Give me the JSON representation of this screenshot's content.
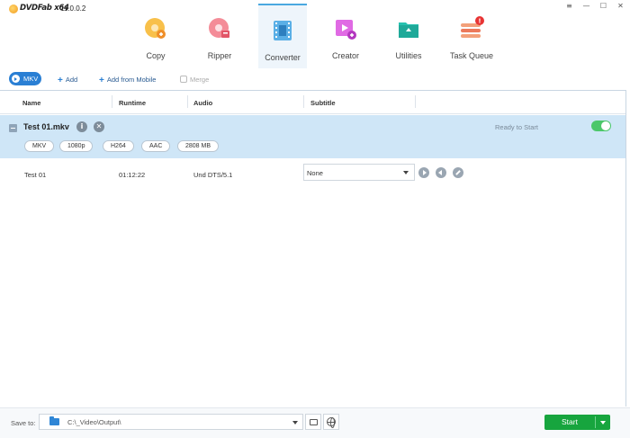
{
  "app": {
    "name": "DVDFab x64",
    "version": "11.0.0.2"
  },
  "window_controls": {
    "menu": "≡",
    "minimize": "—",
    "maximize": "☐",
    "close": "✕"
  },
  "nav": {
    "items": [
      {
        "label": "Copy",
        "icon": "disc-copy-icon",
        "color": "#f5a623"
      },
      {
        "label": "Ripper",
        "icon": "disc-ripper-icon",
        "color": "#ef6f7f"
      },
      {
        "label": "Converter",
        "icon": "film-converter-icon",
        "color": "#3a9bd8",
        "active": true
      },
      {
        "label": "Creator",
        "icon": "video-creator-icon",
        "color": "#d24fd6"
      },
      {
        "label": "Utilities",
        "icon": "utilities-folder-icon",
        "color": "#1fb9a8"
      },
      {
        "label": "Task Queue",
        "icon": "task-queue-icon",
        "color": "#f07a5a",
        "badge": "!"
      }
    ]
  },
  "toolbar": {
    "format": "MKV",
    "add": "Add",
    "add_from_mobile": "Add from Mobile",
    "merge": "Merge"
  },
  "table": {
    "headers": {
      "name": "Name",
      "runtime": "Runtime",
      "audio": "Audio",
      "subtitle": "Subtitle"
    }
  },
  "file": {
    "name": "Test 01.mkv",
    "status": "Ready to Start",
    "tags": [
      "MKV",
      "1080p",
      "H264",
      "AAC",
      "2808 MB"
    ],
    "track": {
      "title": "Test 01",
      "runtime": "01:12:22",
      "audio": "Und  DTS/5.1",
      "subtitle": "None"
    }
  },
  "footer": {
    "save_to_label": "Save to:",
    "path": "C:\\_Video\\Output\\",
    "start": "Start"
  },
  "colors": {
    "accent": "#2a7fd4",
    "start": "#17a53e",
    "toggle_on": "#4cc76a",
    "selected_row": "#cfe6f7"
  }
}
